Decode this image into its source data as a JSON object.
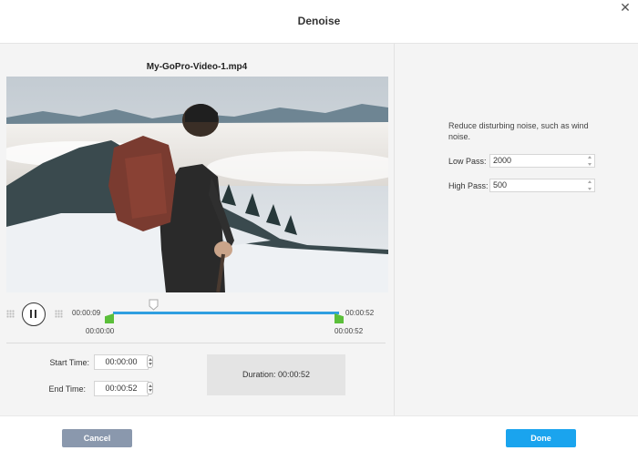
{
  "dialog": {
    "title": "Denoise",
    "close_glyph": "✕"
  },
  "player": {
    "filename": "My-GoPro-Video-1.mp4",
    "current_time": "00:00:09",
    "range_start_label": "00:00:00",
    "range_end_label": "00:00:52",
    "total_time": "00:00:52",
    "state": "playing",
    "playhead_fraction": 0.17
  },
  "trim": {
    "start_label": "Start Time:",
    "start_value": "00:00:00",
    "end_label": "End Time:",
    "end_value": "00:00:52",
    "duration_label": "Duration:",
    "duration_value": "00:00:52"
  },
  "settings": {
    "description": "Reduce disturbing noise, such as wind noise.",
    "low_pass_label": "Low Pass:",
    "low_pass_value": "2000",
    "high_pass_label": "High Pass:",
    "high_pass_value": "500"
  },
  "footer": {
    "cancel_label": "Cancel",
    "done_label": "Done"
  },
  "icons": {
    "close": "close-icon",
    "pause": "pause-icon",
    "grip": "grip-icon",
    "playhead": "playhead-marker-icon"
  },
  "colors": {
    "accent": "#1aa4ee",
    "track": "#2f9fe0",
    "trim_handle": "#5bbf3a",
    "cancel": "#8a98ad"
  }
}
